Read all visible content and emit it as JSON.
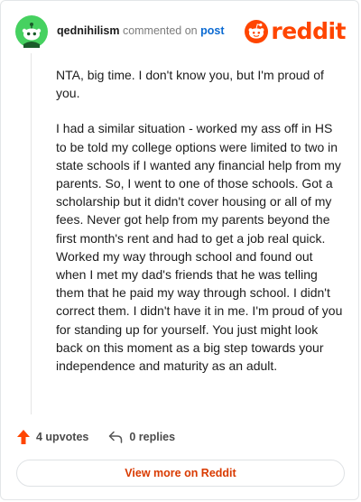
{
  "header": {
    "username": "qednihilism",
    "commented_on": "commented on",
    "post_link": "post",
    "brand": "reddit"
  },
  "comment": {
    "paragraphs": [
      "NTA, big time. I don't know you, but I'm proud of you.",
      "I had a similar situation - worked my ass off in HS to be told my college options were limited to two in state schools if I wanted any financial help from my parents. So, I went to one of those schools. Got a scholarship but it didn't cover housing or all of my fees. Never got help from my parents beyond the first month's rent and had to get a job real quick. Worked my way through school and found out when I met my dad's friends that he was telling them that he paid my way through school. I didn't correct them. I didn't have it in me. I'm proud of you for standing up for yourself. You just might look back on this moment as a big step towards your independence and maturity as an adult."
    ]
  },
  "actions": {
    "upvotes": "4 upvotes",
    "replies": "0 replies"
  },
  "footer": {
    "view_more": "View more on Reddit"
  },
  "colors": {
    "brand": "#ff4500",
    "avatar": "#46d160",
    "link": "#0b6ad2",
    "button_text": "#d93a00"
  },
  "icons": [
    "snoo-avatar-icon",
    "reddit-logo-icon",
    "upvote-arrow-icon",
    "reply-icon"
  ]
}
